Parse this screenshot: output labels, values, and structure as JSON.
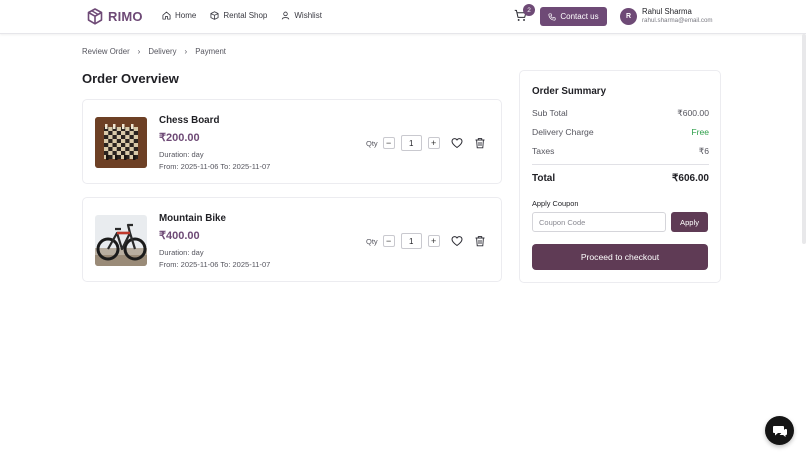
{
  "app": {
    "brand": "RIMO",
    "nav": [
      {
        "label": "Home",
        "icon": "home-icon"
      },
      {
        "label": "Rental Shop",
        "icon": "box-icon"
      },
      {
        "label": "Wishlist",
        "icon": "user-icon"
      }
    ],
    "cart_count": "2",
    "contact_label": "Contact us",
    "user": {
      "initial": "R",
      "name": "Rahul Sharma",
      "email": "rahul.sharma@email.com"
    }
  },
  "breadcrumb": [
    "Review Order",
    "Delivery",
    "Payment"
  ],
  "page_title": "Order Overview",
  "items": [
    {
      "name": "Chess Board",
      "price": "₹200.00",
      "duration": "Duration: day",
      "dates": "From: 2025-11-06 To: 2025-11-07",
      "qty_label": "Qty",
      "qty": "1",
      "image": "chess-board-photo"
    },
    {
      "name": "Mountain Bike",
      "price": "₹400.00",
      "duration": "Duration: day",
      "dates": "From: 2025-11-06 To: 2025-11-07",
      "qty_label": "Qty",
      "qty": "1",
      "image": "mountain-bike-photo"
    }
  ],
  "summary": {
    "title": "Order Summary",
    "rows": [
      {
        "label": "Sub Total",
        "value": "₹600.00"
      },
      {
        "label": "Delivery Charge",
        "value": "Free"
      },
      {
        "label": "Taxes",
        "value": "₹6"
      }
    ],
    "total_label": "Total",
    "total_value": "₹606.00",
    "coupon_label": "Apply Coupon",
    "coupon_placeholder": "Coupon Code",
    "apply_label": "Apply",
    "checkout_label": "Proceed to checkout"
  },
  "colors": {
    "brand": "#6e4a76",
    "button_dark": "#5f3b55",
    "free": "#2e9f4a"
  }
}
